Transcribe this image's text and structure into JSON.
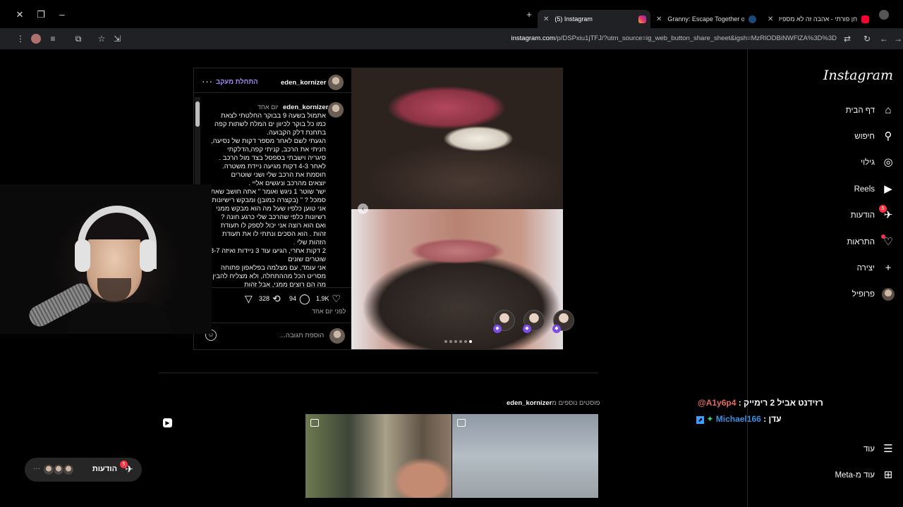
{
  "browser": {
    "tabs": [
      {
        "title": "(5) Instagram",
        "active": true
      },
      {
        "title": "Granny: Escape Together on Ste",
        "active": false
      },
      {
        "title": "חן פורתי - אהבה זה לא מספיק",
        "active": false
      }
    ],
    "url_host": "instagram.com",
    "url_rest": "/p/DSPxiu1jTFJ/?utm_source=ig_web_button_share_sheet&igsh=MzRlODBiNWFlZA%3D%3D"
  },
  "sidebar": {
    "logo": "Instagram",
    "items": [
      {
        "label": "דף הבית",
        "icon": "home-icon"
      },
      {
        "label": "חיפוש",
        "icon": "search-icon"
      },
      {
        "label": "גילוי",
        "icon": "compass-icon"
      },
      {
        "label": "Reels",
        "icon": "reels-icon"
      },
      {
        "label": "הודעות",
        "icon": "messenger-icon",
        "badge": "5"
      },
      {
        "label": "התראות",
        "icon": "heart-icon"
      },
      {
        "label": "יצירה",
        "icon": "plus-icon"
      },
      {
        "label": "פרופיל",
        "icon": "profile-avatar-icon"
      }
    ],
    "bottom": [
      {
        "label": "עוד",
        "icon": "menu-icon"
      },
      {
        "label": "עוד מ-Meta",
        "icon": "meta-grid-icon"
      }
    ]
  },
  "post": {
    "username": "eden_kornizer",
    "follow_label": "התחלת מעקב",
    "caption_username": "eden_kornizer",
    "caption_time": "יום אחד",
    "caption_lines": [
      "אתמול בשעה 9 בבוקר החלטתי לצאת",
      "כמו כל בוקר לכיוון ים המלח לשתות קפה",
      "בתחנת דלק הקבועה.",
      "הגעתי לשם לאחר מספר דקות של נסיעה,",
      "חניתי את הרכב, קניתי קפה,הדלקתי",
      "סיגריה וישבתי בספסל בצד מול הרכב .",
      "לאחר 4-3 דקות מגיעה ניידת משטרה.",
      "חוסמת את הרכב שלי ושני שוטרים",
      "יוצאים מהרכב וניגשים אליי .",
      "ישר שוטר 1 ניגש ואומר \" אתה חושב שאתה",
      "סמכל ? \" (בקצרה כמובן) ומבקש רישיונות",
      "אני טוען כלפיו שעל מה הוא מבקש ממני",
      "רשיונות כלפי שהרכב שלי כרגע חונה ?",
      "ואם הוא רוצה אני יכול לספק לו תעודת",
      "זהות . הוא הסכים ונתתי לו את תעודת",
      "הזהות שלי .",
      "2 דקות אחרי, הגיעו עוד 3 ניידות ואיזה 8-7",
      "שוטרים שונים",
      "אני עומד, עם מצלמה בפלאפון פתוחה",
      "מסריט הכל מההתחלה, ולא מצליח להבין",
      "מה הם רוצים ממני, אבל זהות"
    ],
    "likes": "1.9K",
    "comments": "94",
    "reposts": "328",
    "posted_ago": "לפני יום אחד",
    "comment_placeholder": "הוספת תגובה..."
  },
  "more_posts": {
    "prefix": "פוסטים נוספים מ",
    "username": "eden_kornizer"
  },
  "chat": [
    {
      "author": "@A1y6p4",
      "message": "רזידנט אביל 2 רימייק",
      "author_color": "#e26b5a"
    },
    {
      "author": "Michael166",
      "message": "עדן",
      "author_color": "#3b8fe0"
    }
  ],
  "notifications_pill": {
    "label": "הודעות",
    "badge": "5"
  }
}
